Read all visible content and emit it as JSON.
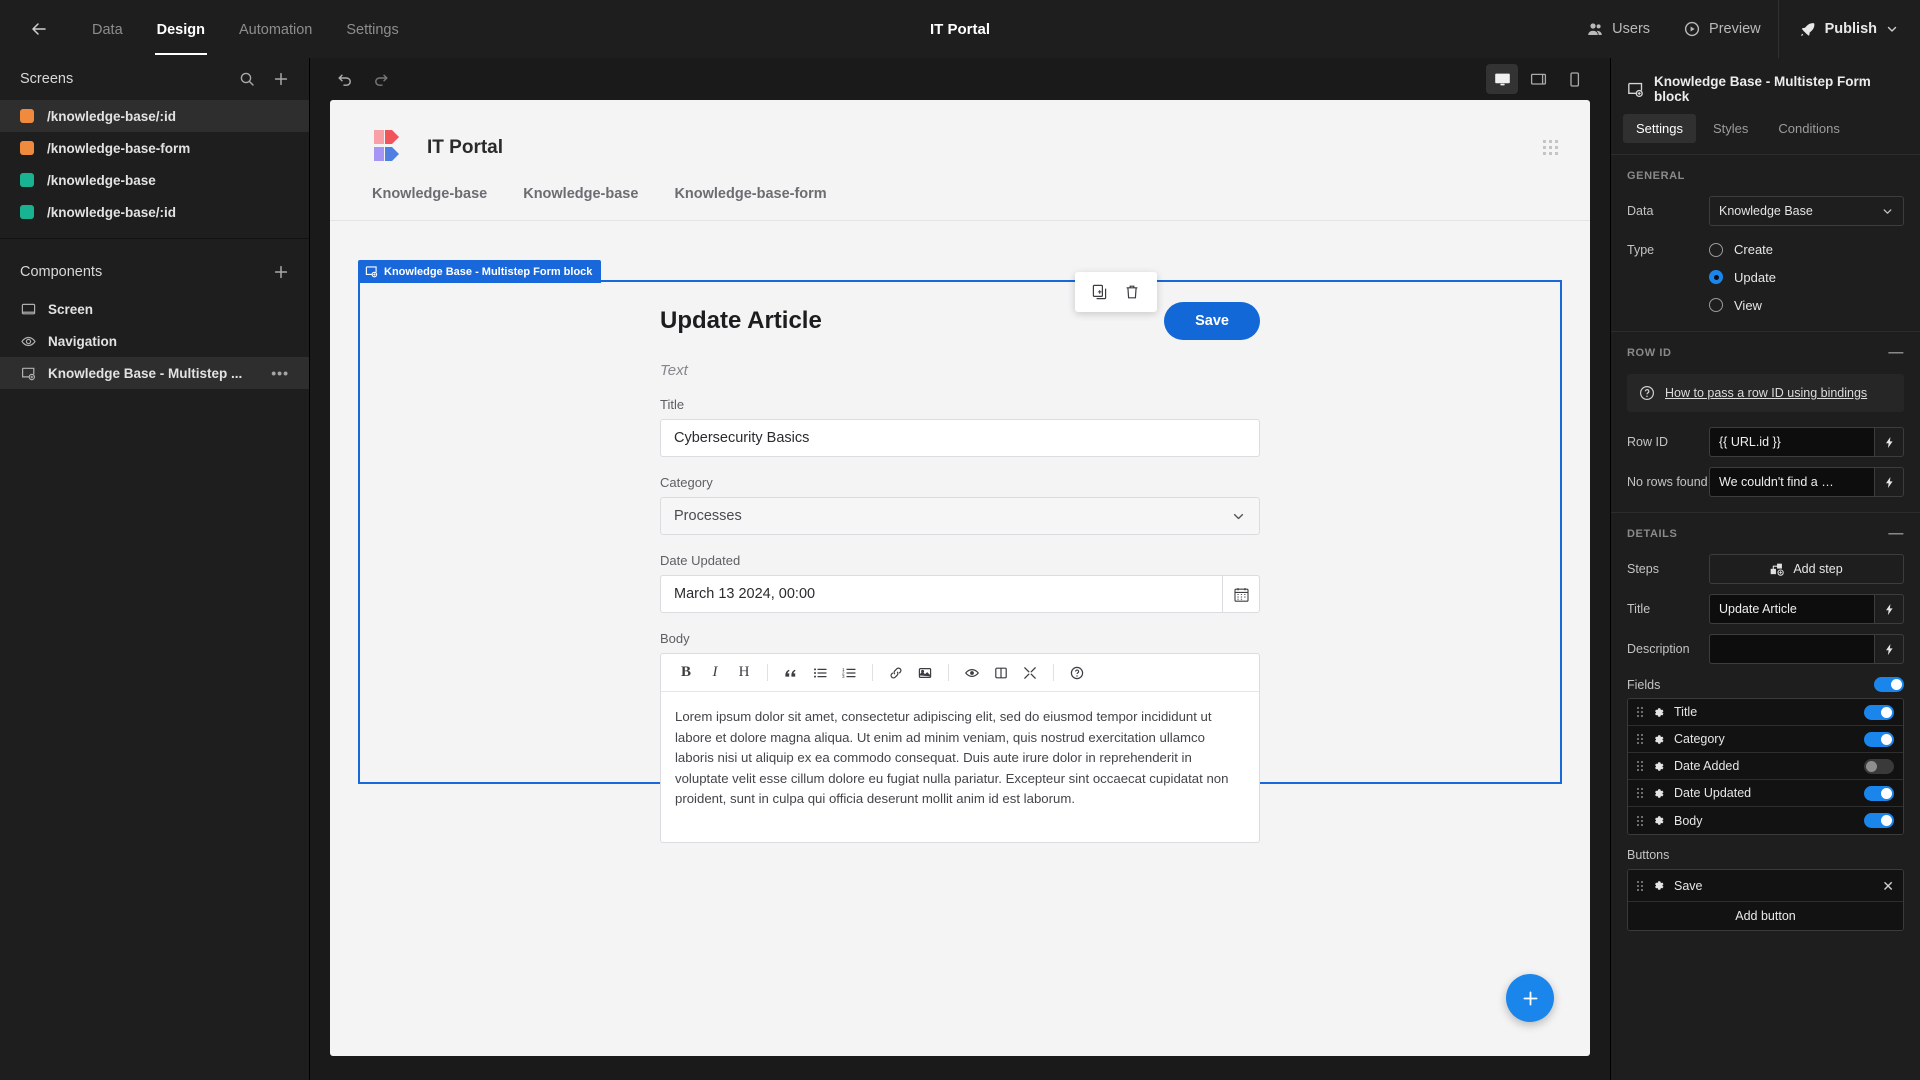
{
  "topbar": {
    "back_icon": "arrow-left-icon",
    "nav": [
      {
        "label": "Data",
        "active": false
      },
      {
        "label": "Design",
        "active": true
      },
      {
        "label": "Automation",
        "active": false
      },
      {
        "label": "Settings",
        "active": false
      }
    ],
    "app_title": "IT Portal",
    "users_label": "Users",
    "preview_label": "Preview",
    "publish_label": "Publish"
  },
  "sidebar": {
    "screens_title": "Screens",
    "screens": [
      {
        "label": "/knowledge-base/:id",
        "color": "#f08a3c",
        "selected": true
      },
      {
        "label": "/knowledge-base-form",
        "color": "#f08a3c",
        "selected": false
      },
      {
        "label": "/knowledge-base",
        "color": "#19b391",
        "selected": false
      },
      {
        "label": "/knowledge-base/:id",
        "color": "#19b391",
        "selected": false
      }
    ],
    "components_title": "Components",
    "components": [
      {
        "label": "Screen",
        "icon": "screen-icon",
        "selected": false,
        "menu": ""
      },
      {
        "label": "Navigation",
        "icon": "eye-icon",
        "selected": false,
        "menu": ""
      },
      {
        "label": "Knowledge Base - Multistep ...",
        "icon": "block-icon",
        "selected": true,
        "menu": "•••"
      }
    ]
  },
  "canvas_bar": {
    "undo_icon": "undo-icon",
    "redo_icon": "redo-icon",
    "devices": [
      {
        "name": "desktop-icon",
        "active": true
      },
      {
        "name": "tablet-icon",
        "active": false
      },
      {
        "name": "mobile-icon",
        "active": false
      }
    ]
  },
  "preview": {
    "logo_title": "IT Portal",
    "nav_links": [
      "Knowledge-base",
      "Knowledge-base",
      "Knowledge-base-form"
    ],
    "float_tools": [
      {
        "name": "duplicate-icon"
      },
      {
        "name": "trash-icon"
      }
    ],
    "block_tag": "Knowledge Base - Multistep Form block",
    "form": {
      "title": "Update Article",
      "save_label": "Save",
      "description": "Text",
      "fields": [
        {
          "label": "Title",
          "type": "text",
          "value": "Cybersecurity Basics"
        },
        {
          "label": "Category",
          "type": "select",
          "value": "Processes"
        },
        {
          "label": "Date Updated",
          "type": "date",
          "value": "March 13 2024, 00:00"
        }
      ],
      "body_label": "Body",
      "editor_tools": [
        "B",
        "I",
        "H",
        "quote-icon",
        "bullet-list-icon",
        "numbered-list-icon",
        "link-icon",
        "image-icon",
        "eye-icon",
        "split-view-icon",
        "fullscreen-icon",
        "help-icon"
      ],
      "body_text": "Lorem ipsum dolor sit amet, consectetur adipiscing elit, sed do eiusmod tempor incididunt ut labore et dolore magna aliqua. Ut enim ad minim veniam, quis nostrud exercitation ullamco laboris nisi ut aliquip ex ea commodo consequat. Duis aute irure dolor in reprehenderit in voluptate velit esse cillum dolore eu fugiat nulla pariatur. Excepteur sint occaecat cupidatat non proident, sunt in culpa qui officia deserunt mollit anim id est laborum."
    },
    "fab_icon": "plus-icon"
  },
  "rpanel": {
    "title": "Knowledge Base - Multistep Form block",
    "tabs": [
      {
        "label": "Settings",
        "active": true
      },
      {
        "label": "Styles",
        "active": false
      },
      {
        "label": "Conditions",
        "active": false
      }
    ],
    "general": {
      "section": "GENERAL",
      "data_label": "Data",
      "data_value": "Knowledge Base",
      "type_label": "Type",
      "type_options": [
        {
          "label": "Create",
          "selected": false
        },
        {
          "label": "Update",
          "selected": true
        },
        {
          "label": "View",
          "selected": false
        }
      ]
    },
    "row_id": {
      "section": "ROW ID",
      "help_link": "How to pass a row ID using bindings",
      "row_id_label": "Row ID",
      "row_id_value": "{{ URL.id }}",
      "no_rows_label": "No rows found",
      "no_rows_value": "We couldn't find a …"
    },
    "details": {
      "section": "DETAILS",
      "steps_label": "Steps",
      "add_step_label": "Add step",
      "title_label": "Title",
      "title_value": "Update Article",
      "description_label": "Description",
      "description_value": "",
      "fields_label": "Fields",
      "fields_master_on": true,
      "fields": [
        {
          "name": "Title",
          "on": true
        },
        {
          "name": "Category",
          "on": true
        },
        {
          "name": "Date Added",
          "on": false
        },
        {
          "name": "Date Updated",
          "on": true
        },
        {
          "name": "Body",
          "on": true
        }
      ],
      "buttons_label": "Buttons",
      "buttons": [
        {
          "name": "Save"
        }
      ],
      "add_button_label": "Add button"
    }
  },
  "colors": {
    "accent": "#1a86ec",
    "save_blue": "#1168d6",
    "tag_blue": "#1868db",
    "orange": "#f08a3c",
    "green": "#19b391"
  }
}
